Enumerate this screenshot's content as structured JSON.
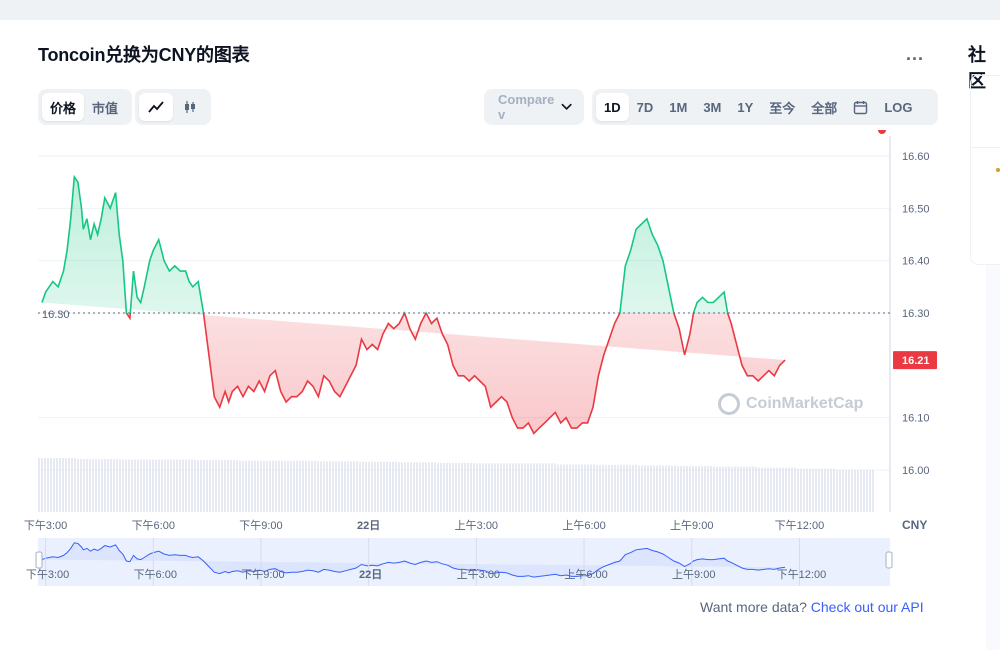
{
  "header": {
    "title": "Toncoin兑换为CNY的图表",
    "more_label": "...",
    "side_title": "社区"
  },
  "toolbar": {
    "metric_tabs": [
      "价格",
      "市值"
    ],
    "compare_label": "Compare v",
    "range_tabs": [
      "1D",
      "7D",
      "1M",
      "3M",
      "1Y",
      "至今",
      "全部"
    ],
    "log_label": "LOG",
    "active_metric": "价格",
    "active_range": "1D"
  },
  "watermark": "CoinMarketCap",
  "footer": {
    "text": "Want more data? ",
    "link": "Check out our API"
  },
  "colors": {
    "up": "#16c784",
    "down": "#ea3943",
    "accent": "#3861fb"
  },
  "chart_data": {
    "type": "area",
    "reference_value": 16.3,
    "reference_label": "16.30",
    "current_value": 16.21,
    "current_label": "16.21",
    "ylim": [
      16.0,
      16.6
    ],
    "yticks": [
      "16.60",
      "16.50",
      "16.40",
      "16.30",
      "16.10",
      "16.00"
    ],
    "ytick_values": [
      16.6,
      16.5,
      16.4,
      16.3,
      16.1,
      16.0
    ],
    "currency": "CNY",
    "x_tick_labels": [
      "下午3:00",
      "下午6:00",
      "下午9:00",
      "22日",
      "上午3:00",
      "上午6:00",
      "上午9:00",
      "下午12:00"
    ],
    "x_hours": [
      15,
      18,
      21,
      24,
      27,
      30,
      33,
      36
    ],
    "x_start_hour": 14.9,
    "x_end_hour": 38.3,
    "x": [
      14.9,
      15.0,
      15.1,
      15.2,
      15.35,
      15.5,
      15.6,
      15.7,
      15.8,
      15.9,
      16.0,
      16.05,
      16.15,
      16.25,
      16.35,
      16.45,
      16.55,
      16.65,
      16.8,
      16.95,
      17.05,
      17.15,
      17.25,
      17.35,
      17.45,
      17.55,
      17.65,
      17.75,
      17.9,
      18.0,
      18.15,
      18.3,
      18.45,
      18.6,
      18.75,
      18.9,
      19.0,
      19.1,
      19.25,
      19.4,
      19.55,
      19.7,
      19.85,
      20.0,
      20.1,
      20.2,
      20.35,
      20.5,
      20.65,
      20.8,
      20.95,
      21.1,
      21.25,
      21.4,
      21.55,
      21.7,
      21.85,
      22.0,
      22.15,
      22.3,
      22.45,
      22.6,
      22.75,
      22.9,
      23.05,
      23.2,
      23.35,
      23.5,
      23.65,
      23.8,
      23.95,
      24.1,
      24.25,
      24.4,
      24.55,
      24.7,
      24.85,
      25.0,
      25.15,
      25.3,
      25.45,
      25.6,
      25.75,
      25.9,
      26.05,
      26.2,
      26.35,
      26.5,
      26.65,
      26.8,
      26.95,
      27.1,
      27.25,
      27.4,
      27.55,
      27.7,
      27.85,
      28.0,
      28.15,
      28.3,
      28.45,
      28.6,
      28.75,
      28.9,
      29.05,
      29.2,
      29.35,
      29.5,
      29.65,
      29.8,
      29.95,
      30.1,
      30.25,
      30.4,
      30.55,
      30.7,
      30.85,
      31.0,
      31.15,
      31.3,
      31.45,
      31.6,
      31.75,
      31.9,
      32.05,
      32.2,
      32.35,
      32.5,
      32.65,
      32.8,
      32.95,
      33.05,
      33.15,
      33.3,
      33.45,
      33.6,
      33.75,
      33.9,
      34.0,
      34.1,
      34.25,
      34.4,
      34.55,
      34.7,
      34.85,
      35.0,
      35.15,
      35.3,
      35.45,
      35.6,
      35.75,
      35.9,
      36.05,
      36.2,
      36.35,
      36.5,
      36.65,
      36.8,
      36.95,
      37.1,
      37.25,
      37.4,
      37.55,
      37.7,
      37.85,
      38.0,
      38.1,
      38.2,
      38.3
    ],
    "values": [
      16.32,
      16.34,
      16.35,
      16.36,
      16.35,
      16.38,
      16.42,
      16.48,
      16.56,
      16.55,
      16.5,
      16.46,
      16.48,
      16.44,
      16.47,
      16.45,
      16.48,
      16.52,
      16.5,
      16.53,
      16.45,
      16.4,
      16.3,
      16.29,
      16.38,
      16.33,
      16.32,
      16.35,
      16.4,
      16.42,
      16.44,
      16.4,
      16.38,
      16.39,
      16.38,
      16.38,
      16.36,
      16.35,
      16.36,
      16.3,
      16.22,
      16.14,
      16.12,
      16.15,
      16.13,
      16.15,
      16.16,
      16.14,
      16.16,
      16.15,
      16.17,
      16.15,
      16.18,
      16.19,
      16.15,
      16.13,
      16.14,
      16.14,
      16.15,
      16.17,
      16.16,
      16.14,
      16.18,
      16.17,
      16.15,
      16.14,
      16.16,
      16.18,
      16.2,
      16.25,
      16.23,
      16.24,
      16.23,
      16.26,
      16.28,
      16.27,
      16.28,
      16.3,
      16.27,
      16.25,
      16.28,
      16.3,
      16.28,
      16.29,
      16.26,
      16.24,
      16.2,
      16.18,
      16.18,
      16.17,
      16.18,
      16.17,
      16.16,
      16.12,
      16.13,
      16.14,
      16.13,
      16.1,
      16.08,
      16.08,
      16.09,
      16.07,
      16.08,
      16.09,
      16.1,
      16.11,
      16.09,
      16.1,
      16.08,
      16.08,
      16.09,
      16.09,
      16.12,
      16.18,
      16.22,
      16.25,
      16.28,
      16.3,
      16.39,
      16.42,
      16.46,
      16.47,
      16.48,
      16.45,
      16.43,
      16.4,
      16.35,
      16.3,
      16.27,
      16.22,
      16.26,
      16.3,
      16.32,
      16.33,
      16.32,
      16.32,
      16.33,
      16.34,
      16.3,
      16.28,
      16.24,
      16.2,
      16.18,
      16.18,
      16.17,
      16.18,
      16.19,
      16.18,
      16.2,
      16.21
    ],
    "volume_relative": [
      1,
      0.98,
      0.97,
      0.97,
      0.96,
      0.95,
      0.95,
      0.94,
      0.93,
      0.92,
      0.91,
      0.9,
      0.9,
      0.88,
      0.87,
      0.86,
      0.85,
      0.84,
      0.82,
      0.8,
      0.78
    ],
    "navigator_labels": [
      "下午3:00",
      "下午6:00",
      "下午9:00",
      "22日",
      "上午3:00",
      "上午6:00",
      "上午9:00",
      "下午12:00"
    ]
  }
}
